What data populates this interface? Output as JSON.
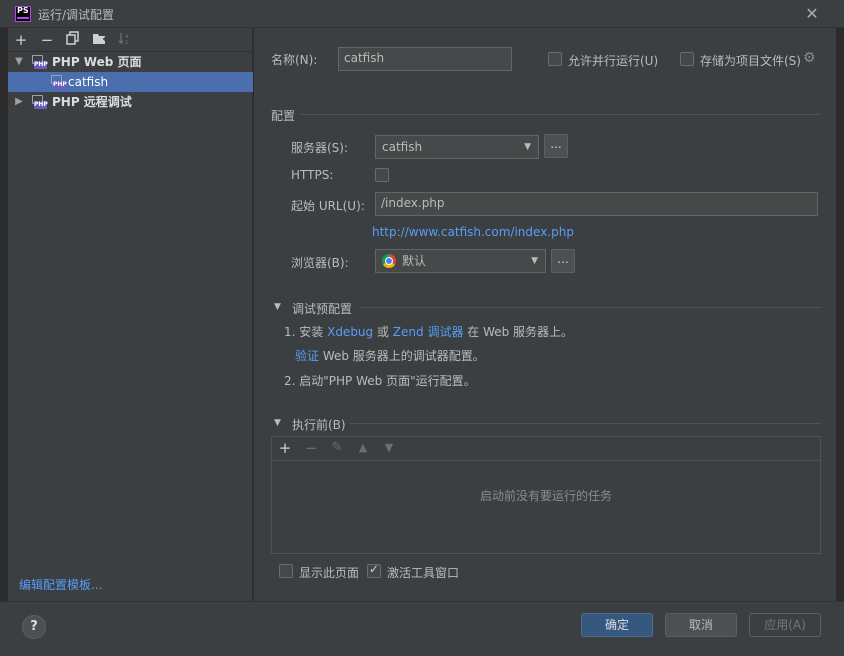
{
  "window": {
    "title": "运行/调试配置",
    "app_badge": "PS"
  },
  "tree_toolbar": {
    "add": "+",
    "remove": "−"
  },
  "tree": {
    "group_web": "PHP Web 页面",
    "item_catfish": "catfish",
    "group_remote": "PHP 远程调试",
    "badge": "PHP"
  },
  "edit_templates": "编辑配置模板...",
  "form": {
    "name_label": "名称(N):",
    "name_value": "catfish",
    "allow_parallel": "允许并行运行(U)",
    "store_as_file": "存储为项目文件(S)",
    "section_config": "配置",
    "server_label": "服务器(S):",
    "server_value": "catfish",
    "dots": "...",
    "https_label": "HTTPS:",
    "url_label": "起始 URL(U):",
    "url_value": "/index.php",
    "full_url": "http://www.catfish.com/index.php",
    "browser_label": "浏览器(B):",
    "browser_value": "默认"
  },
  "debug": {
    "title": "调试预配置",
    "step1_prefix": "1. 安装 ",
    "xdebug": "Xdebug",
    "or": " 或 ",
    "zend": "Zend 调试器",
    "step1_suffix": " 在 Web 服务器上。",
    "verify": "验证",
    "verify_suffix": " Web 服务器上的调试器配置。",
    "step2": "2. 启动\"PHP Web 页面\"运行配置。"
  },
  "before_launch": {
    "title": "执行前(B)",
    "empty": "启动前没有要运行的任务"
  },
  "options": {
    "show_page": "显示此页面",
    "activate_tool": "激活工具窗口"
  },
  "buttons": {
    "help": "?",
    "ok": "确定",
    "cancel": "取消",
    "apply": "应用(A)"
  }
}
